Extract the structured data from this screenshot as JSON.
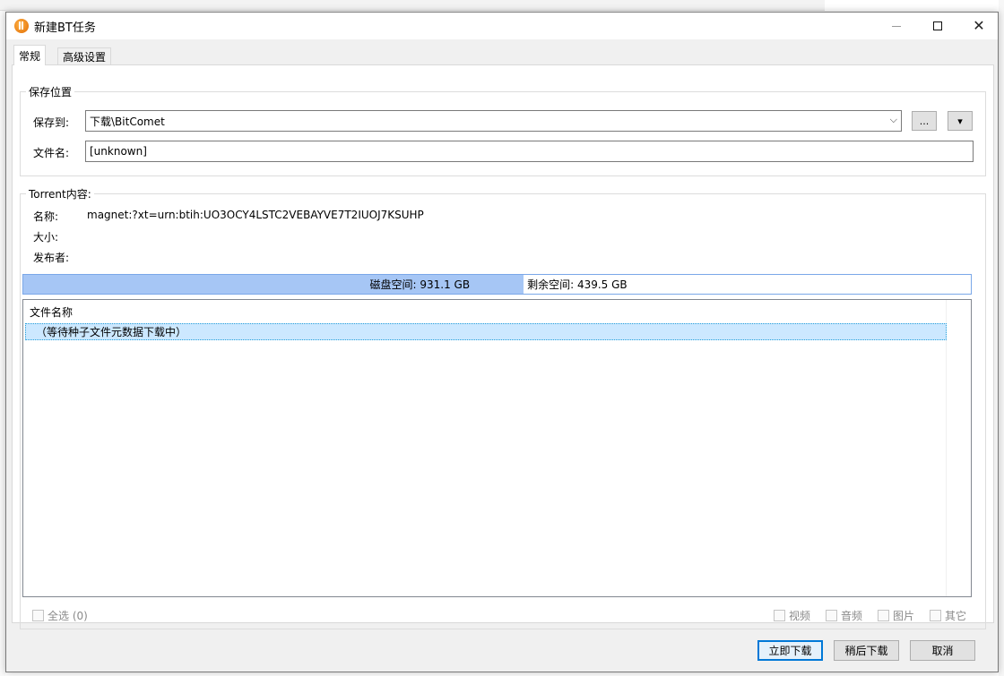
{
  "window": {
    "title": "新建BT任务"
  },
  "tabs": [
    {
      "label": "常规",
      "active": true
    },
    {
      "label": "高级设置",
      "active": false
    }
  ],
  "save_location": {
    "group_label": "保存位置",
    "save_to_label": "保存到:",
    "save_to_value": "下载\\BitComet",
    "browse_button": "...",
    "dropdown_button": "▾",
    "filename_label": "文件名:",
    "filename_value": "[unknown]"
  },
  "torrent": {
    "group_label": "Torrent内容:",
    "name_label": "名称:",
    "name_value": "magnet:?xt=urn:btih:UO3OCY4LSTC2VEBAYVE7T2IUOJ7KSUHP",
    "size_label": "大小:",
    "publisher_label": "发布者:"
  },
  "disk": {
    "disk_space": "磁盘空间:   931.1 GB",
    "free_space": "剩余空间:   439.5 GB",
    "used_fraction": 0.528
  },
  "file_list": {
    "header": "文件名称",
    "rows": [
      "（等待种子文件元数据下载中）"
    ]
  },
  "filters": {
    "select_all": "全选 (0)",
    "video": "视频",
    "audio": "音频",
    "image": "图片",
    "other": "其它"
  },
  "buttons": {
    "download_now": "立即下载",
    "download_later": "稍后下载",
    "cancel": "取消"
  },
  "colors": {
    "accent": "#0078d7",
    "selection": "#cce8ff",
    "space_fill": "#a6c6f5"
  },
  "icons": {
    "app": "bitcomet-app-icon",
    "combo": "chevron-down-icon"
  }
}
